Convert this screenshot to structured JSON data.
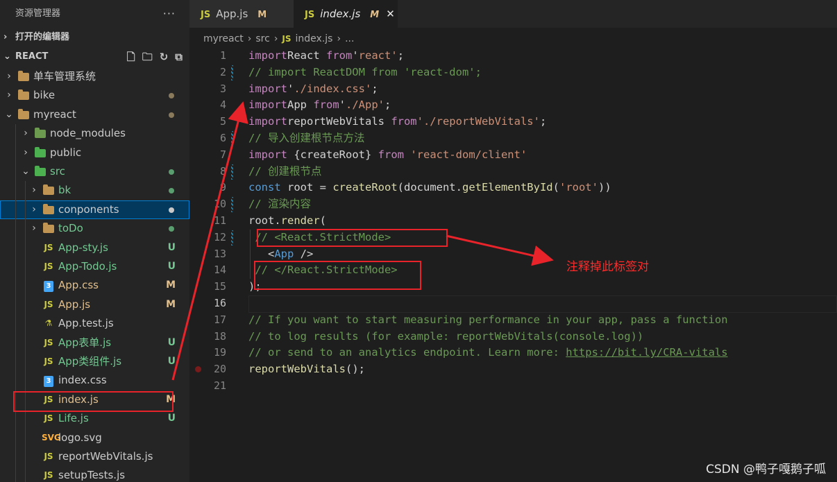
{
  "sidebar": {
    "title": "资源管理器",
    "more": "···",
    "open_editors": "打开的编辑器",
    "project": "REACT",
    "tree": [
      {
        "label": "单车管理系统",
        "kind": "folder",
        "depth": 0,
        "open": false,
        "status": ""
      },
      {
        "label": "bike",
        "kind": "folder",
        "depth": 0,
        "open": false,
        "status": "dot"
      },
      {
        "label": "myreact",
        "kind": "folder",
        "depth": 0,
        "open": true,
        "status": "dot"
      },
      {
        "label": "node_modules",
        "kind": "folder-node",
        "depth": 1,
        "open": false,
        "status": ""
      },
      {
        "label": "public",
        "kind": "folder-public",
        "depth": 1,
        "open": false,
        "status": ""
      },
      {
        "label": "src",
        "kind": "folder-src",
        "depth": 1,
        "open": true,
        "status": "dot-green"
      },
      {
        "label": "bk",
        "kind": "folder",
        "depth": 2,
        "open": false,
        "status": "dot-green"
      },
      {
        "label": "conponents",
        "kind": "folder",
        "depth": 2,
        "open": false,
        "status": "dot-grey",
        "selected": true
      },
      {
        "label": "toDo",
        "kind": "folder",
        "depth": 2,
        "open": false,
        "status": "dot-green"
      },
      {
        "label": "App-sty.js",
        "kind": "js",
        "depth": 2,
        "status": "U"
      },
      {
        "label": "App-Todo.js",
        "kind": "js",
        "depth": 2,
        "status": "U"
      },
      {
        "label": "App.css",
        "kind": "css",
        "depth": 2,
        "status": "M"
      },
      {
        "label": "App.js",
        "kind": "js",
        "depth": 2,
        "status": "M"
      },
      {
        "label": "App.test.js",
        "kind": "test",
        "depth": 2,
        "status": ""
      },
      {
        "label": "App表单.js",
        "kind": "js",
        "depth": 2,
        "status": "U"
      },
      {
        "label": "App类组件.js",
        "kind": "js",
        "depth": 2,
        "status": "U"
      },
      {
        "label": "index.css",
        "kind": "css",
        "depth": 2,
        "status": ""
      },
      {
        "label": "index.js",
        "kind": "js",
        "depth": 2,
        "status": "M"
      },
      {
        "label": "Life.js",
        "kind": "js",
        "depth": 2,
        "status": "U"
      },
      {
        "label": "logo.svg",
        "kind": "svg",
        "depth": 2,
        "status": ""
      },
      {
        "label": "reportWebVitals.js",
        "kind": "js",
        "depth": 2,
        "status": ""
      },
      {
        "label": "setupTests.js",
        "kind": "js",
        "depth": 2,
        "status": ""
      }
    ]
  },
  "tabs": [
    {
      "icon": "JS",
      "label": "App.js",
      "modified": "M",
      "active": false
    },
    {
      "icon": "JS",
      "label": "index.js",
      "modified": "M",
      "active": true,
      "close": "✕"
    }
  ],
  "breadcrumb": {
    "parts": [
      "myreact",
      "src",
      "index.js",
      "..."
    ],
    "icon": "JS"
  },
  "editor": {
    "lines": [
      [
        [
          "kw2",
          "import"
        ],
        [
          "",
          "React "
        ],
        [
          "kw2",
          "from"
        ],
        [
          "",
          "'"
        ],
        [
          "str",
          "react"
        ],
        [
          "str",
          "'"
        ],
        [
          "",
          ";"
        ]
      ],
      [
        [
          "cm",
          "// import ReactDOM from 'react-dom';"
        ]
      ],
      [
        [
          "kw2",
          "import"
        ],
        [
          "",
          "'"
        ],
        [
          "str",
          "./index.css"
        ],
        [
          "str",
          "'"
        ],
        [
          "",
          ";"
        ]
      ],
      [
        [
          "kw2",
          "import"
        ],
        [
          "",
          "App "
        ],
        [
          "kw2",
          "from"
        ],
        [
          "",
          "'"
        ],
        [
          "str",
          "./App"
        ],
        [
          "str",
          "'"
        ],
        [
          "",
          ";"
        ]
      ],
      [
        [
          "kw2",
          "import"
        ],
        [
          "",
          "reportWebVitals "
        ],
        [
          "kw2",
          "from"
        ],
        [
          "",
          ""
        ],
        [
          "str",
          "'./reportWebVitals'"
        ],
        [
          "",
          ";"
        ]
      ],
      [
        [
          "cm",
          "// 导入创建根节点方法"
        ]
      ],
      [
        [
          "kw2",
          "import"
        ],
        [
          "",
          " {createRoot} "
        ],
        [
          "kw2",
          "from"
        ],
        [
          "",
          " "
        ],
        [
          "str",
          "'react-dom/client'"
        ]
      ],
      [
        [
          "cm",
          "// 创建根节点"
        ]
      ],
      [
        [
          "kw",
          "const"
        ],
        [
          "",
          " root = "
        ],
        [
          "fn",
          "createRoot"
        ],
        [
          "",
          "(document."
        ],
        [
          "fn",
          "getElementById"
        ],
        [
          "",
          "("
        ],
        [
          "str",
          "'root'"
        ],
        [
          "",
          "))"
        ]
      ],
      [
        [
          "cm",
          "// 渲染内容"
        ]
      ],
      [
        [
          "",
          "root."
        ],
        [
          "fn",
          "render"
        ],
        [
          "",
          "("
        ]
      ],
      [
        [
          "",
          " "
        ],
        [
          "cm",
          "// <React.StrictMode>"
        ]
      ],
      [
        [
          "",
          "   <"
        ],
        [
          "tag",
          "App"
        ],
        [
          "",
          " />"
        ]
      ],
      [
        [
          "",
          " "
        ],
        [
          "cm",
          "// </React.StrictMode>"
        ]
      ],
      [
        [
          "",
          ");"
        ]
      ],
      [
        [
          "",
          ""
        ]
      ],
      [
        [
          "cm",
          "// If you want to start measuring performance in your app, pass a function"
        ]
      ],
      [
        [
          "cm",
          "// to log results (for example: reportWebVitals(console.log))"
        ]
      ],
      [
        [
          "cm",
          "// or send to an analytics endpoint. Learn more: "
        ],
        [
          "lnk",
          "https://bit.ly/CRA-vitals"
        ]
      ],
      [
        [
          "fn",
          "reportWebVitals"
        ],
        [
          "",
          "();"
        ]
      ],
      [
        [
          "",
          ""
        ]
      ]
    ]
  },
  "annotation": {
    "note": "注释掉此标签对",
    "color": "#e8232a"
  },
  "watermark": "CSDN @鸭子嘎鹅子呱"
}
